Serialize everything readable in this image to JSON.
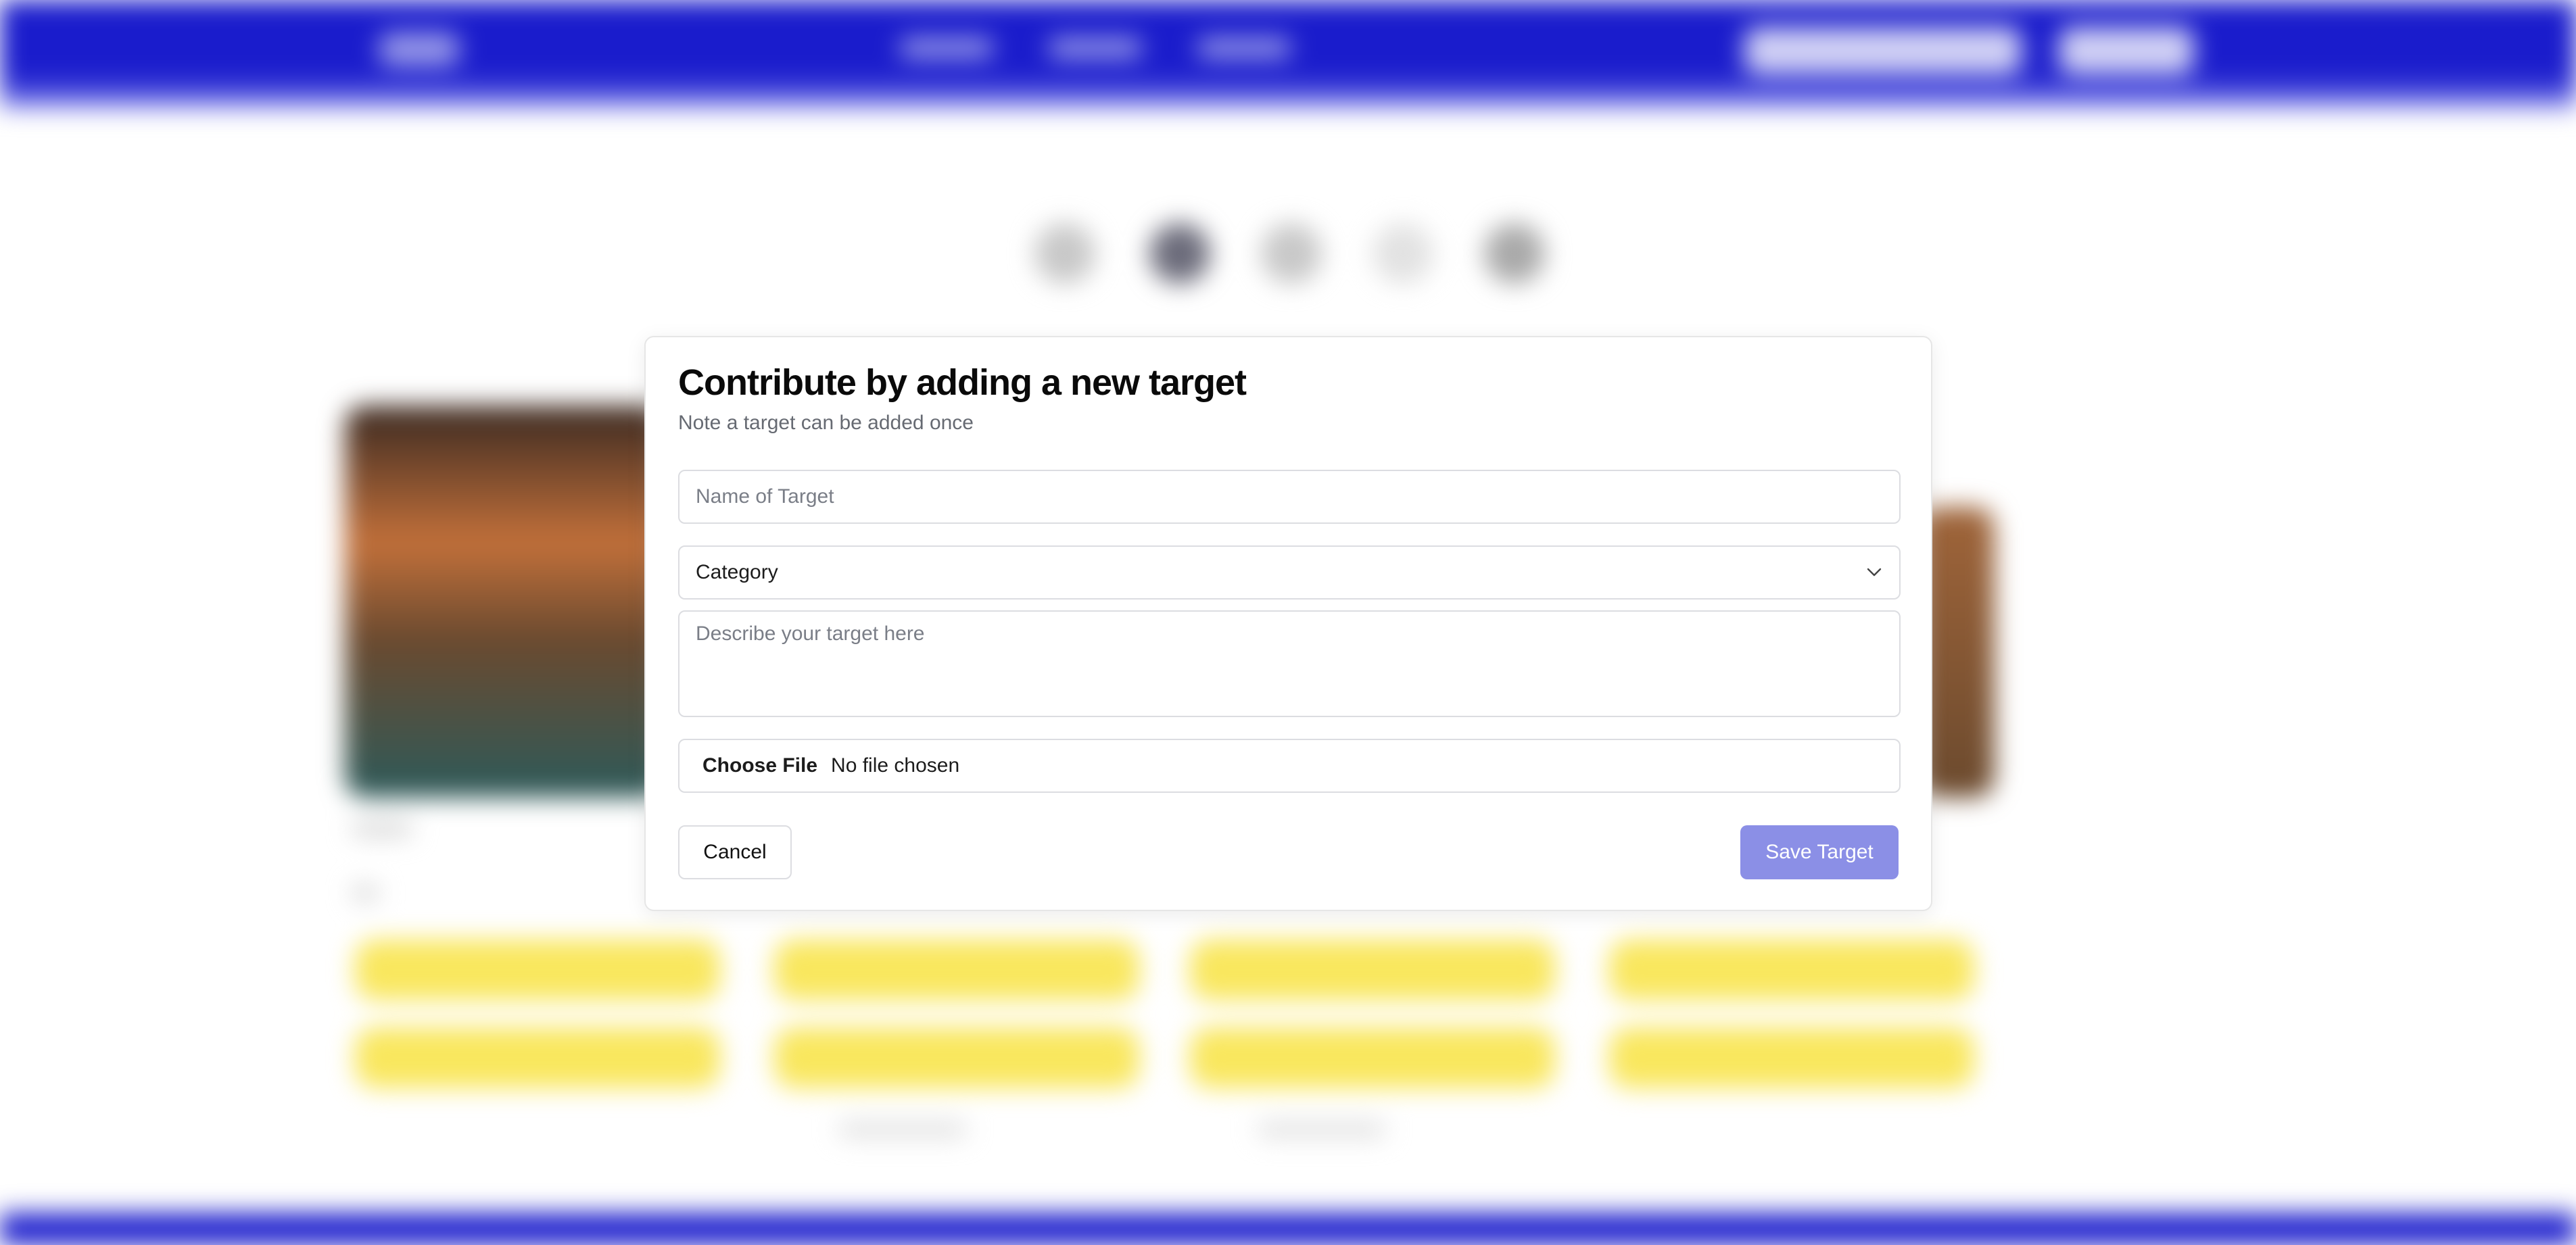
{
  "colors": {
    "brand": "#1a1ccc",
    "accent_yellow": "#f9e75e",
    "save_button": "#8b8fe6"
  },
  "modal": {
    "title": "Contribute by adding a new target",
    "subtitle": "Note a target can be added once",
    "name_placeholder": "Name of Target",
    "category_label": "Category",
    "category_icon": "chevron-down-icon",
    "description_placeholder": "Describe your target here",
    "file_button_label": "Choose File",
    "file_status": "No file chosen",
    "cancel_label": "Cancel",
    "save_label": "Save Target"
  }
}
